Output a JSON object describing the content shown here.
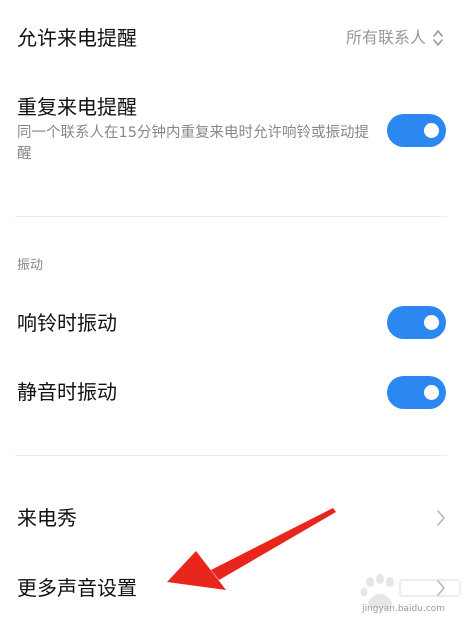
{
  "settings": {
    "allow_calls": {
      "title": "允许来电提醒",
      "value": "所有联系人",
      "icon": "updown-icon"
    },
    "repeat_calls": {
      "title": "重复来电提醒",
      "description": "同一个联系人在15分钟内重复来电时允许响铃或振动提醒",
      "enabled": true
    },
    "vibration_section": {
      "label": "振动"
    },
    "vibrate_ringing": {
      "title": "响铃时振动",
      "enabled": true
    },
    "vibrate_silent": {
      "title": "静音时振动",
      "enabled": true
    },
    "caller_show": {
      "title": "来电秀",
      "icon": "chevron-right-icon"
    },
    "more_sound": {
      "title": "更多声音设置",
      "icon": "chevron-right-icon"
    }
  },
  "overlay": {
    "annotation_arrow_color": "#e8261c",
    "watermark_icon": "baidu-paw-icon",
    "watermark_text": "jingyan.baidu.com"
  },
  "colors": {
    "toggle_on": "#2c88f0",
    "text_primary": "#111111",
    "text_secondary": "#888888"
  }
}
